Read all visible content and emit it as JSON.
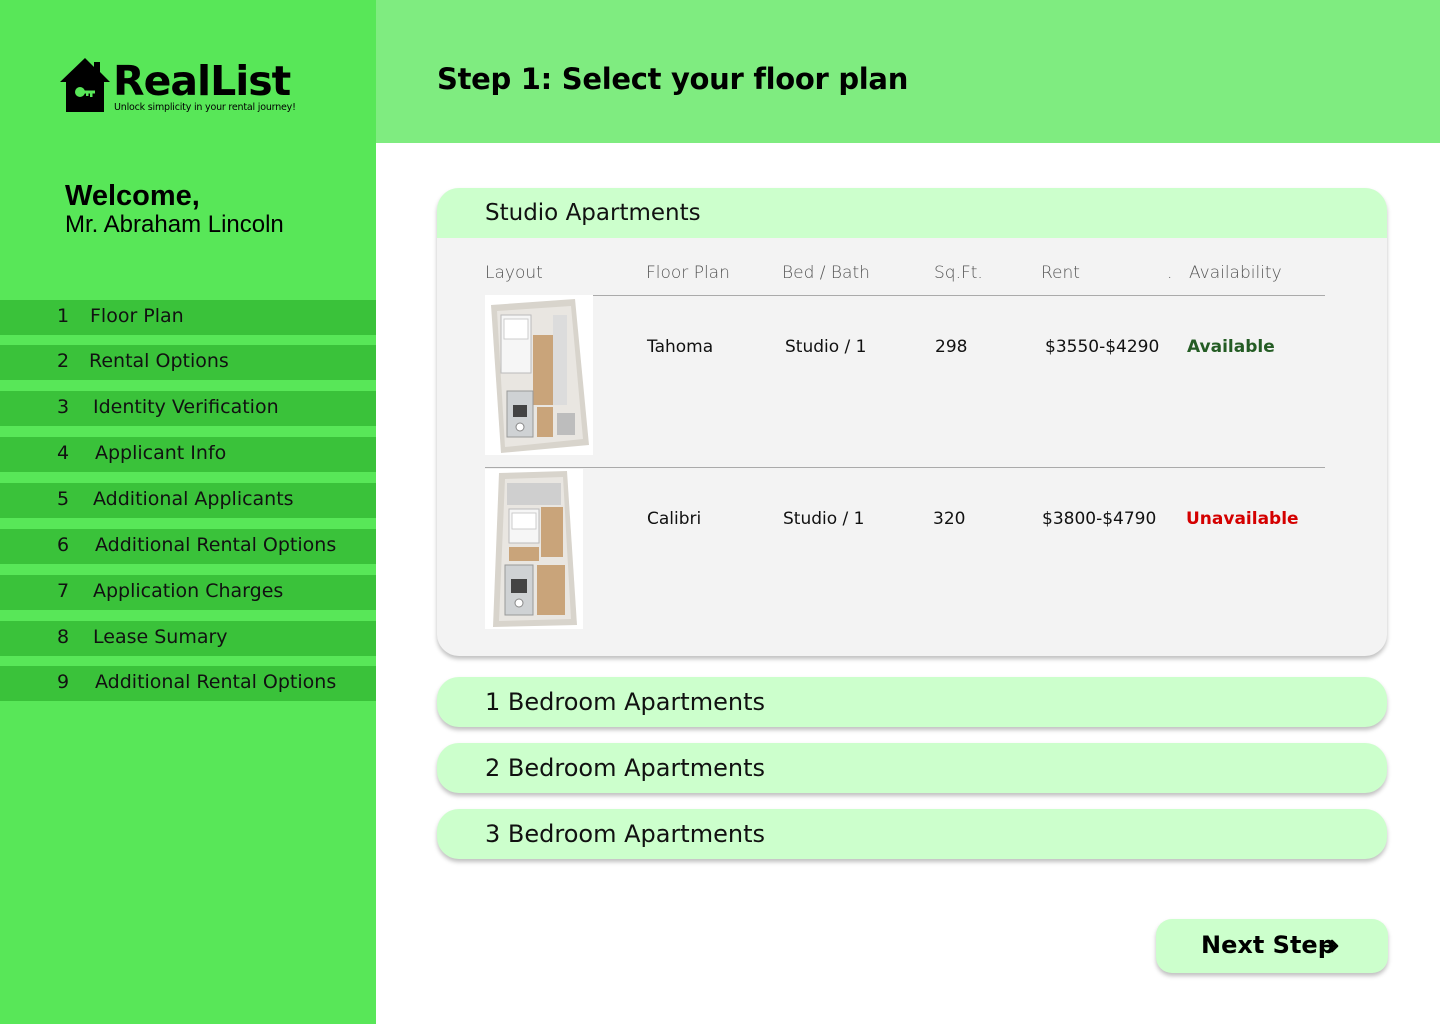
{
  "brand": {
    "name": "RealList",
    "tagline": "Unlock simplicity in your rental journey!",
    "logo_icon": "house-key-icon"
  },
  "sidebar": {
    "welcome": "Welcome,",
    "user_name": "Mr. Abraham Lincoln",
    "steps": [
      {
        "num": "1",
        "label": "Floor Plan"
      },
      {
        "num": "2",
        "label": "Rental Options"
      },
      {
        "num": "3",
        "label": "Identity Verification"
      },
      {
        "num": "4",
        "label": "Applicant Info"
      },
      {
        "num": "5",
        "label": "Additional Applicants"
      },
      {
        "num": "6",
        "label": "Additional Rental Options"
      },
      {
        "num": "7",
        "label": "Application Charges"
      },
      {
        "num": "8",
        "label": "Lease Sumary"
      },
      {
        "num": "9",
        "label": "Additional Rental Options"
      }
    ]
  },
  "header": {
    "title": "Step 1: Select your floor plan"
  },
  "studio": {
    "title": "Studio Apartments",
    "columns": [
      "Layout",
      "Floor Plan",
      "Bed / Bath",
      "Sq.Ft.",
      "Rent",
      ".",
      "Availability"
    ],
    "rows": [
      {
        "floor_plan": "Tahoma",
        "bed_bath": "Studio / 1",
        "sqft": "298",
        "rent": "$3550-$4290",
        "availability": "Available"
      },
      {
        "floor_plan": "Calibri",
        "bed_bath": "Studio / 1",
        "sqft": "320",
        "rent": "$3800-$4790",
        "availability": "Unavailable"
      }
    ]
  },
  "accordions": [
    {
      "title": "1 Bedroom Apartments"
    },
    {
      "title": "2 Bedroom Apartments"
    },
    {
      "title": "3 Bedroom Apartments"
    }
  ],
  "next_button": {
    "label": "Next Step",
    "icon": "arrow-right-icon"
  },
  "colors": {
    "sidebar_bg": "#58e758",
    "step_bg": "#3ac23a",
    "header_bg": "#7fec80",
    "panel_head": "#ccffcc",
    "available": "#245c24",
    "unavailable": "#d40000"
  }
}
